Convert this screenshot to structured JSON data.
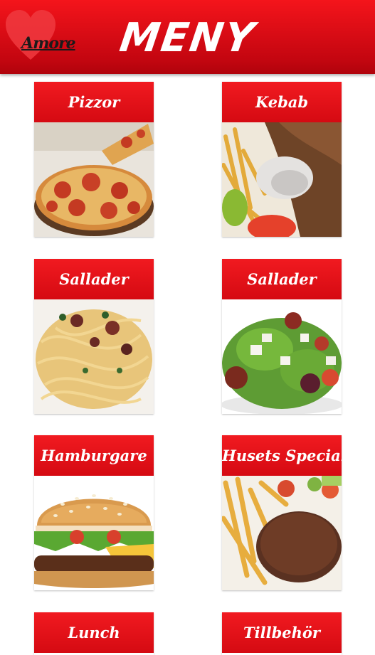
{
  "header": {
    "logo_text": "Amore",
    "title": "MENY",
    "brand_color": "#d40810"
  },
  "menu": {
    "items": [
      {
        "label": "Pizzor",
        "image": "pizza-photo"
      },
      {
        "label": "Kebab",
        "image": "kebab-plate-photo"
      },
      {
        "label": "Sallader",
        "image": "pasta-photo"
      },
      {
        "label": "Sallader",
        "image": "greek-salad-photo"
      },
      {
        "label": "Hamburgare",
        "image": "burger-photo"
      },
      {
        "label": "Husets Special",
        "image": "steak-fries-photo"
      },
      {
        "label": "Lunch",
        "image": "lunch-photo"
      },
      {
        "label": "Tillbehör",
        "image": "sides-photo"
      }
    ]
  }
}
